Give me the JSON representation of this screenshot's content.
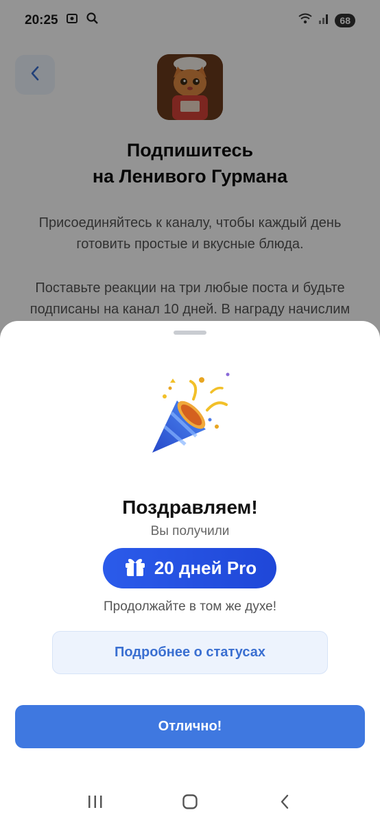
{
  "status_bar": {
    "time": "20:25",
    "battery": "68"
  },
  "background": {
    "title_line1": "Подпишитесь",
    "title_line2": "на Ленивого Гурмана",
    "description_line1": "Присоединяйтесь к каналу, чтобы каждый день",
    "description_line2": "готовить простые и вкусные блюда.",
    "description2_line1": "Поставьте реакции на три любые поста и будьте",
    "description2_line2": "подписаны на канал 10 дней. В награду начислим",
    "avatar_label": "Ленивый гурман"
  },
  "sheet": {
    "heading": "Поздравляем!",
    "received": "Вы получили",
    "reward": "20 дней Pro",
    "encouragement": "Продолжайте в том же духе!",
    "more_button": "Подробнее о статусах",
    "ok_button": "Отлично!"
  },
  "icons": {
    "back": "chevron-left-icon",
    "gift": "gift-icon",
    "party": "party-popper-icon",
    "nav_recents": "recents-icon",
    "nav_home": "home-icon",
    "nav_back": "nav-back-icon"
  },
  "colors": {
    "accent": "#3f78e0",
    "pill": "#2b5bea",
    "secondary_button_bg": "#edf3fd"
  }
}
